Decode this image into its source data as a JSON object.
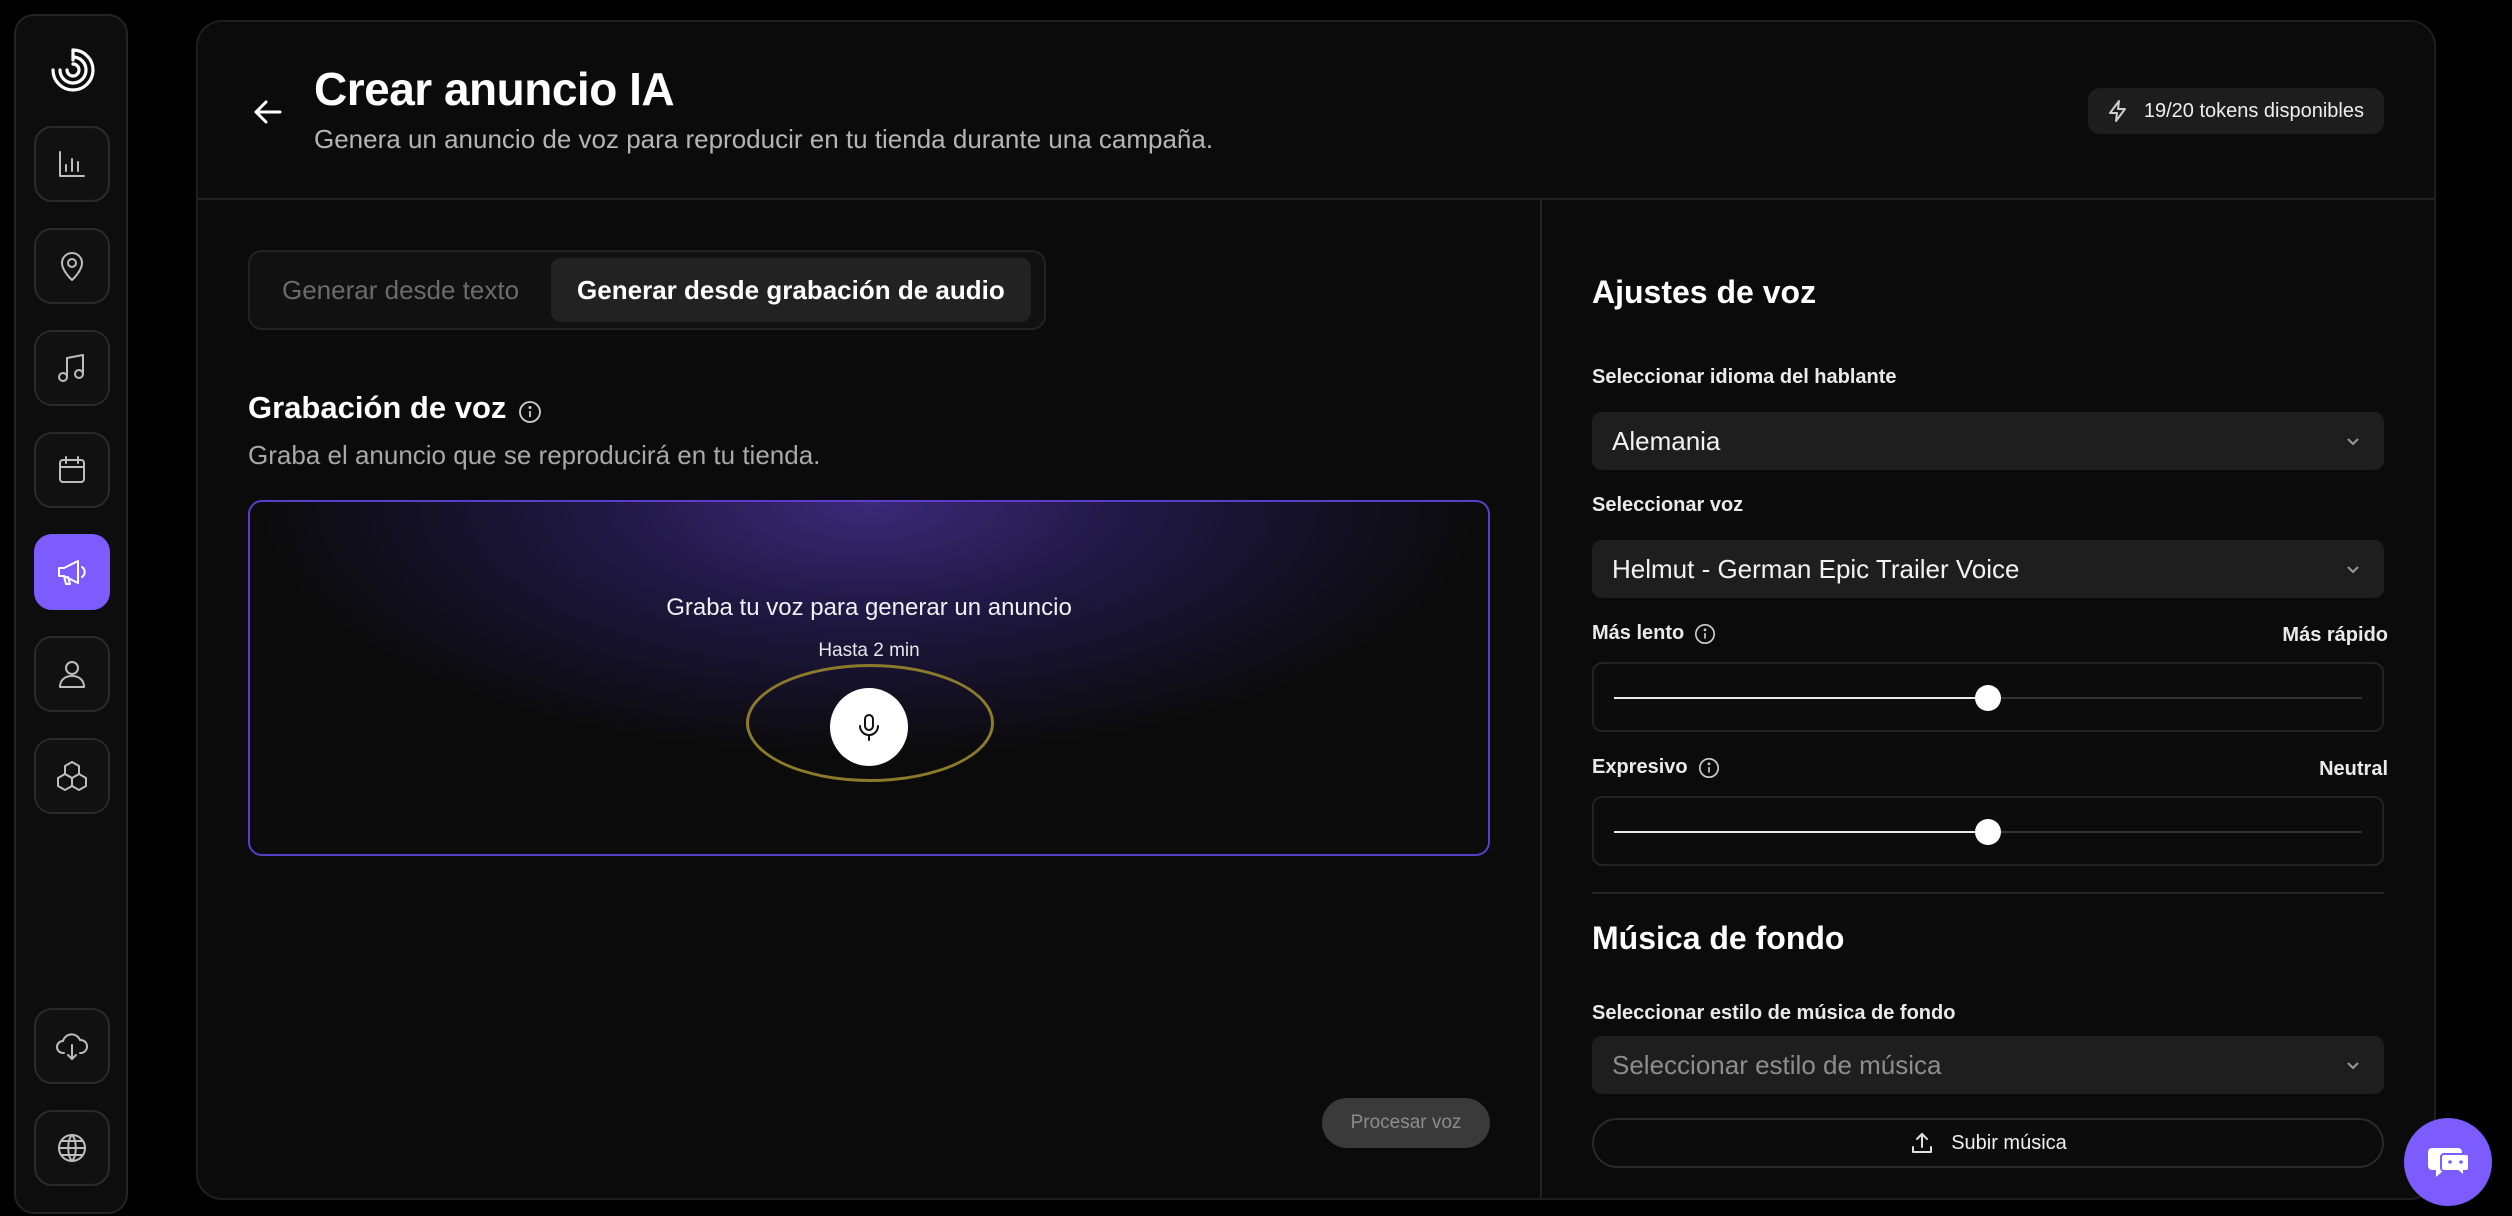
{
  "sidebar": {
    "items": [
      {
        "icon": "bar-chart-icon"
      },
      {
        "icon": "location-pin-icon"
      },
      {
        "icon": "music-note-icon"
      },
      {
        "icon": "calendar-icon"
      },
      {
        "icon": "megaphone-icon",
        "active": true
      },
      {
        "icon": "user-icon"
      },
      {
        "icon": "cubes-icon"
      }
    ],
    "bottom_items": [
      {
        "icon": "cloud-download-icon"
      },
      {
        "icon": "globe-icon"
      }
    ]
  },
  "header": {
    "title": "Crear anuncio IA",
    "subtitle": "Genera un anuncio de voz para reproducir en tu tienda durante una campaña.",
    "tokens": "19/20 tokens disponibles"
  },
  "tabs": [
    {
      "label": "Generar desde texto",
      "active": false
    },
    {
      "label": "Generar desde grabación de audio",
      "active": true
    }
  ],
  "recording": {
    "title": "Grabación de voz",
    "subtitle": "Graba el anuncio que se reproducirá en tu tienda.",
    "prompt": "Graba tu voz para generar un anuncio",
    "limit": "Hasta 2 min"
  },
  "process_button": "Procesar voz",
  "voice_settings": {
    "title": "Ajustes de voz",
    "language_label": "Seleccionar idioma del hablante",
    "language_value": "Alemania",
    "voice_label": "Seleccionar voz",
    "voice_value": "Helmut - German Epic Trailer Voice",
    "speed": {
      "left_label": "Más lento",
      "right_label": "Más rápido",
      "value": 0.5
    },
    "style": {
      "left_label": "Expresivo",
      "right_label": "Neutral",
      "value": 0.5
    }
  },
  "music": {
    "title": "Música de fondo",
    "style_label": "Seleccionar estilo de música de fondo",
    "style_placeholder": "Seleccionar estilo de música",
    "upload_label": "Subir música"
  },
  "colors": {
    "accent": "#7c5cff",
    "background": "#0b0b0b"
  }
}
